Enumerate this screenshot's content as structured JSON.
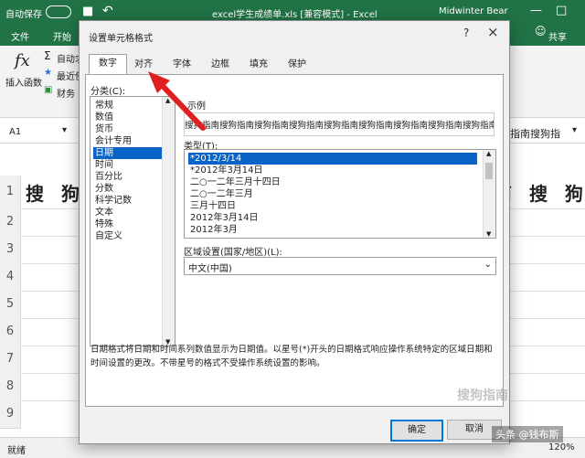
{
  "excel": {
    "autosave_label": "自动保存",
    "autosave_state": "关",
    "window_title": "excel学生成绩单.xls  [兼容模式] - Excel",
    "user": "Midwinter Bear",
    "tabs": [
      "文件",
      "开始"
    ],
    "share": "共享",
    "ribbon": {
      "insert_function": "插入函数",
      "autosum": "自动求",
      "recent": "最近使",
      "finance": "财务"
    },
    "namebox": "A1",
    "row1_left": "搜 狗",
    "row1_right": "南 搜 狗",
    "right_formula_text": "指南搜狗指",
    "row_numbers": [
      "1",
      "2",
      "3",
      "4",
      "5",
      "6",
      "7",
      "8",
      "9",
      "10",
      "11"
    ],
    "status_ready": "就绪",
    "zoom": "120%"
  },
  "dialog": {
    "title": "设置单元格格式",
    "help": "?",
    "close": "×",
    "tabs": [
      "数字",
      "对齐",
      "字体",
      "边框",
      "填充",
      "保护"
    ],
    "category_label": "分类(C):",
    "categories": [
      "常规",
      "数值",
      "货币",
      "会计专用",
      "日期",
      "时间",
      "百分比",
      "分数",
      "科学记数",
      "文本",
      "特殊",
      "自定义"
    ],
    "selected_category": 4,
    "sample_label": "示例",
    "sample_value": "搜狗指南搜狗指南搜狗指南搜狗指南搜狗指南搜狗指南搜狗指南搜狗指南搜狗指南搜狗指",
    "type_label": "类型(T):",
    "types": [
      "*2012/3/14",
      "*2012年3月14日",
      "二○一二年三月十四日",
      "二○一二年三月",
      "三月十四日",
      "2012年3月14日",
      "2012年3月"
    ],
    "selected_type": 0,
    "locale_label": "区域设置(国家/地区)(L):",
    "locale_value": "中文(中国)",
    "description": "日期格式将日期和时间系列数值显示为日期值。以星号(*)开头的日期格式响应操作系统特定的区域日期和时间设置的更改。不带星号的格式不受操作系统设置的影响。",
    "ok": "确定",
    "cancel": "取消"
  },
  "watermark": {
    "site": "搜狗指南",
    "credit": "头条 @钱布斯"
  },
  "colors": {
    "excel_green": "#217346",
    "selection_blue": "#0a64c8",
    "arrow_red": "#e02020"
  }
}
